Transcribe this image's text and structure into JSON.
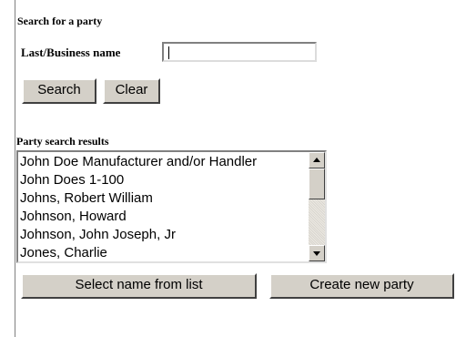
{
  "search_section": {
    "heading": "Search for a party",
    "name_label": "Last/Business name",
    "name_value": "",
    "search_button": "Search",
    "clear_button": "Clear"
  },
  "results_section": {
    "heading": "Party search results",
    "items": [
      "John Doe Manufacturer and/or Handler",
      "John Does 1-100",
      "Johns, Robert William",
      "Johnson, Howard",
      "Johnson, John Joseph, Jr",
      "Jones, Charlie"
    ],
    "scroll_position": 0.0
  },
  "actions": {
    "select_button": "Select name from list",
    "create_button": "Create new party"
  },
  "icons": {
    "scroll_up": "arrow-up-icon",
    "scroll_down": "arrow-down-icon"
  }
}
